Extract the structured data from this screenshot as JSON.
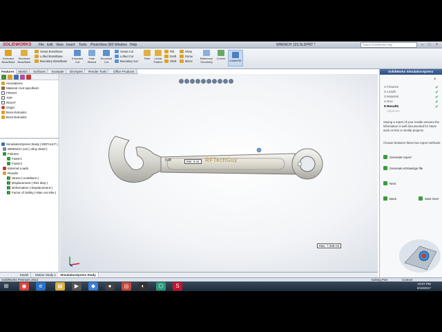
{
  "window": {
    "logo": "SOLIDWORKS",
    "menus": [
      "File",
      "Edit",
      "View",
      "Insert",
      "Tools",
      "PhotoView 360",
      "Window",
      "Help"
    ],
    "title": "WRENCH 123.SLDPRT *",
    "search_placeholder": "Search SolidWorks Help"
  },
  "command_manager": {
    "tools_big": [
      "Extruded Boss/Base",
      "Revolved Boss/Base",
      "Extruded Cut",
      "Hole Wizard",
      "Revolved Cut",
      "Fillet",
      "Linear Pattern",
      "Reference Geometry",
      "Curves",
      "Instant3D"
    ],
    "tools_rows": [
      "Swept Boss/Base",
      "Lofted Boss/Base",
      "Boundary Boss/Base",
      "Swept Cut",
      "Lofted Cut",
      "Boundary Cut",
      "Rib",
      "Draft",
      "Shell",
      "Wrap",
      "Dome",
      "Mirror"
    ],
    "tabs": [
      "Features",
      "Sketch",
      "Surfaces",
      "Evaluate",
      "DimXpert",
      "Render Tools",
      "Office Products"
    ]
  },
  "feature_tree": {
    "part_nodes": [
      "Annotations",
      "Material <not specified>",
      "FRONT",
      "TOP",
      "RIGHT",
      "Origin",
      "Boss-Extrude1",
      "Boss-Extrude2"
    ],
    "study_nodes": [
      "SimulationXpress Study (-DEFAULT-)",
      "WRENCH 123 (-Alloy Steel-)",
      "Fixtures",
      "Fixed-1",
      "Fixed-2",
      "External Loads",
      "Results",
      "Stress (-vonMises-)",
      "Displacement (-Res disp-)",
      "Deformation (-Displacement-)",
      "Factor of Safety (-Max von Mis-)"
    ]
  },
  "viewport": {
    "wrench_size": "5/8",
    "wrench_text": "RFTechGuy",
    "min_tag": "Min: 0.41",
    "max_tag": "Max: 7.26E-04"
  },
  "doc_tabs": [
    "Model",
    "Motion Study 1",
    "SimulationXpress Study"
  ],
  "task_pane": {
    "header": "SolidWorks SimulationXpress",
    "steps": [
      {
        "num": "1",
        "label": "Fixtures"
      },
      {
        "num": "2",
        "label": "Loads"
      },
      {
        "num": "3",
        "label": "Material"
      },
      {
        "num": "4",
        "label": "Run"
      },
      {
        "num": "5",
        "label": "Results"
      },
      {
        "num": "",
        "label": "Optimize"
      }
    ],
    "intro": "Saving a report of your results ensures the information is well documented for future work on this or similar projects.",
    "choose": "Choose between these two report methods:",
    "generate_report": "Generate report",
    "generate_edrawings": "Generate eDrawings file",
    "next": "Next",
    "back": "Back",
    "start_over": "Start Over"
  },
  "status_bar": {
    "product": "SolidWorks Premium 2012",
    "mode": "Editing Part",
    "units": "Custom"
  },
  "taskbar": {
    "time": "10:07 PM",
    "date": "6/16/2017"
  }
}
